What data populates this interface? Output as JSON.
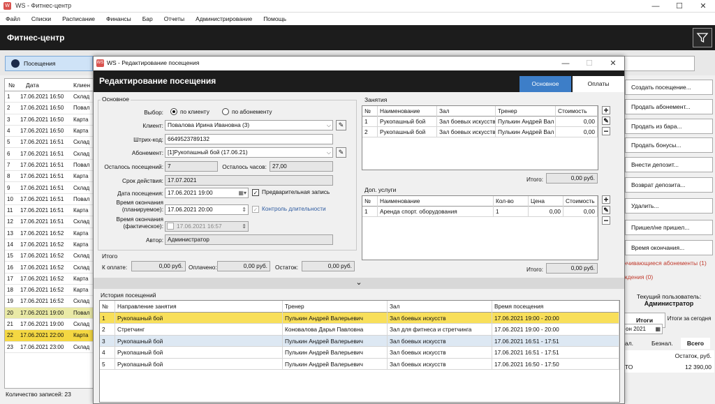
{
  "app": {
    "title": "WS - Фитнес-центр",
    "header_title": "Фитнес-центр"
  },
  "menu": [
    "Файл",
    "Списки",
    "Расписание",
    "Финансы",
    "Бар",
    "Отчеты",
    "Администрирование",
    "Помощь"
  ],
  "nav": {
    "visits_label": "Посещения"
  },
  "bg_table": {
    "headers": [
      "№",
      "Дата",
      "Клиен"
    ],
    "rows": [
      [
        "1",
        "17.06.2021 16:50",
        "Склад"
      ],
      [
        "2",
        "17.06.2021 16:50",
        "Повал"
      ],
      [
        "3",
        "17.06.2021 16:50",
        "Карта"
      ],
      [
        "4",
        "17.06.2021 16:50",
        "Карта"
      ],
      [
        "5",
        "17.06.2021 16:51",
        "Склад"
      ],
      [
        "6",
        "17.06.2021 16:51",
        "Склад"
      ],
      [
        "7",
        "17.06.2021 16:51",
        "Повал"
      ],
      [
        "8",
        "17.06.2021 16:51",
        "Карта"
      ],
      [
        "9",
        "17.06.2021 16:51",
        "Склад"
      ],
      [
        "10",
        "17.06.2021 16:51",
        "Повал"
      ],
      [
        "11",
        "17.06.2021 16:51",
        "Карта"
      ],
      [
        "12",
        "17.06.2021 16:51",
        "Склад"
      ],
      [
        "13",
        "17.06.2021 16:52",
        "Карта"
      ],
      [
        "14",
        "17.06.2021 16:52",
        "Карта"
      ],
      [
        "15",
        "17.06.2021 16:52",
        "Склад"
      ],
      [
        "16",
        "17.06.2021 16:52",
        "Склад"
      ],
      [
        "17",
        "17.06.2021 16:52",
        "Карта"
      ],
      [
        "18",
        "17.06.2021 16:52",
        "Карта"
      ],
      [
        "19",
        "17.06.2021 16:52",
        "Склад"
      ],
      [
        "20",
        "17.06.2021 19:00",
        "Повал"
      ],
      [
        "21",
        "17.06.2021 19:00",
        "Склад"
      ],
      [
        "22",
        "17.06.2021 22:00",
        "Карта"
      ],
      [
        "23",
        "17.06.2021 23:00",
        "Склад"
      ]
    ],
    "count_label": "Количество записей: 23"
  },
  "right_panel": {
    "buttons": [
      "Создать посещение...",
      "Продать абонемент...",
      "Продать из бара...",
      "Продать бонусы...",
      "Внести депозит...",
      "Возврат депозита...",
      "Удалить...",
      "Пришел/не пришел...",
      "Время окончания..."
    ],
    "links": [
      "нчивающиеся абонементы (1)",
      "ждения (0)"
    ],
    "current_user_label": "Текущий пользователь:",
    "current_user": "Администратор",
    "tab_totals": "Итоги",
    "tab_today": "Итоги за сегодня",
    "date_value": "он 2021",
    "cols": [
      "ал.",
      "Безнал.",
      "Всего"
    ],
    "balance_label": "Остаток, руб.",
    "balance_row_label": "ТО",
    "balance_value": "12 390,00"
  },
  "dialog": {
    "window_title": "WS - Редактирование посещения",
    "header": "Редактирование посещения",
    "tab_main": "Основное",
    "tab_payments": "Оплаты",
    "main_group": "Основное",
    "choice_label": "Выбор:",
    "radio_client": "по клиенту",
    "radio_subscription": "по абонементу",
    "client_label": "Клиент:",
    "client_value": "Повалова Ирина Ивановна (3)",
    "barcode_label": "Штрих-код:",
    "barcode_value": "6649523789132",
    "subscription_label": "Абонемент:",
    "subscription_value": "[1]Рукопашный бой (17.06.21)",
    "visits_left_label": "Осталось посещений:",
    "visits_left_value": "7",
    "hours_left_label": "Осталось часов:",
    "hours_left_value": "27,00",
    "valid_until_label": "Срок действия:",
    "valid_until_value": "17.07.2021",
    "visit_date_label": "Дата посещения:",
    "visit_date_value": "17.06.2021 19:00",
    "prebook_label": "Предварительная запись",
    "end_planned_label": "Время окончания\n(планируемое):",
    "end_planned_value": "17.06.2021 20:00",
    "duration_control_label": "Контроль длительности",
    "end_actual_label": "Время окончания\n(фактическое):",
    "end_actual_value": "17.06.2021 16:57",
    "author_label": "Автор:",
    "author_value": "Администратор",
    "totals_group": "Итого",
    "to_pay_label": "К оплате:",
    "to_pay_value": "0,00 руб.",
    "paid_label": "Оплачено:",
    "paid_value": "0,00 руб.",
    "rest_label": "Остаток:",
    "rest_value": "0,00 руб.",
    "classes_group": "Занятия",
    "classes_headers": [
      "№",
      "Наименование",
      "Зал",
      "Тренер",
      "Стоимость"
    ],
    "classes_rows": [
      [
        "1",
        "Рукопашный бой",
        "Зал боевых искусств",
        "Пулькин Андрей Вал",
        "0,00"
      ],
      [
        "2",
        "Рукопашный бой",
        "Зал боевых искусств",
        "Пулькин Андрей Вал",
        "0,00"
      ]
    ],
    "classes_total_label": "Итого:",
    "classes_total_value": "0,00 руб.",
    "extras_group": "Доп. услуги",
    "extras_headers": [
      "№",
      "Наименование",
      "Кол-во",
      "Цена",
      "Стоимость"
    ],
    "extras_rows": [
      [
        "1",
        "Аренда спорт. оборудования",
        "1",
        "0,00",
        "0,00"
      ]
    ],
    "extras_total_label": "Итого:",
    "extras_total_value": "0,00 руб.",
    "history_group": "История посещений",
    "history_headers": [
      "№",
      "Направление занятия",
      "Тренер",
      "Зал",
      "Время посещения"
    ],
    "history_rows": [
      [
        "1",
        "Рукопашный бой",
        "Пулькин Андрей Валерьевич",
        "Зал боевых искусств",
        "17.06.2021 19:00 - 20:00"
      ],
      [
        "2",
        "Стретчинг",
        "Коновалова Дарья Павловна",
        "Зал для фитнеса и стретчинга",
        "17.06.2021 19:00 - 20:00"
      ],
      [
        "3",
        "Рукопашный бой",
        "Пулькин Андрей Валерьевич",
        "Зал боевых искусств",
        "17.06.2021 16:51 - 17:51"
      ],
      [
        "4",
        "Рукопашный бой",
        "Пулькин Андрей Валерьевич",
        "Зал боевых искусств",
        "17.06.2021 16:51 - 17:51"
      ],
      [
        "5",
        "Рукопашный бой",
        "Пулькин Андрей Валерьевич",
        "Зал боевых искусств",
        "17.06.2021 16:50 - 17:50"
      ]
    ]
  }
}
